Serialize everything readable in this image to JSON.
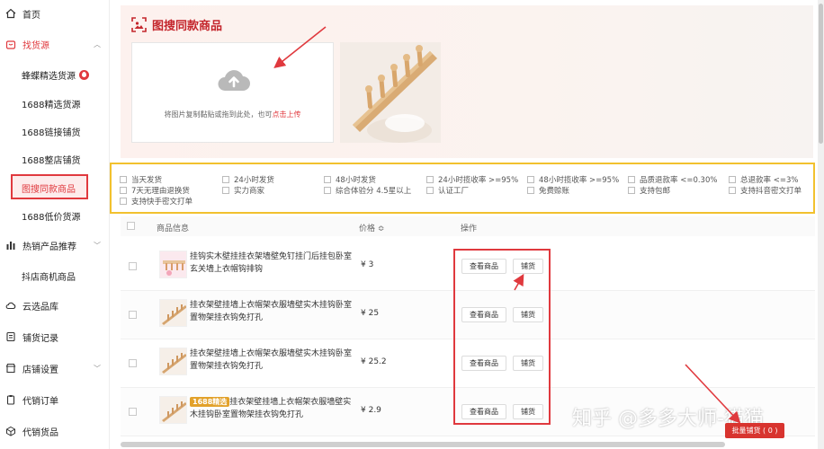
{
  "sidebar": {
    "home": "首页",
    "find_source": "找货源",
    "sub": {
      "wild": "蜂蝶精选货源",
      "p1688": "1688精选货源",
      "link_dist": "1688链接铺货",
      "shop_dist": "1688整店铺货",
      "img_search": "图搜同款商品",
      "low_price": "1688低价货源"
    },
    "hot": "热销产品推荐",
    "douyin": "抖店商机商品",
    "cloud_lib": "云选品库",
    "dist_record": "铺货记录",
    "shop_settings": "店铺设置",
    "agent_order": "代销订单",
    "agent_goods": "代销货品"
  },
  "page": {
    "title": "图搜同款商品",
    "upload_hint": "将图片复制黏贴或拖到此处，也可",
    "upload_link": "点击上传"
  },
  "filters": {
    "row1": [
      "当天发货",
      "24小时发货",
      "48小时发货",
      "24小时揽收率 >=95%",
      "48小时揽收率 >=95%",
      "品质退款率 <=0.30%",
      "总退款率 <=3%"
    ],
    "row2": [
      "7天无理由退换货",
      "实力商家",
      "综合体验分 4.5星以上",
      "认证工厂",
      "免费赊账",
      "支持包邮",
      "支持抖音密文打单"
    ],
    "row3": [
      "支持快手密文打单"
    ]
  },
  "table": {
    "headers": {
      "info": "商品信息",
      "price": "价格 ≎",
      "op": "操作"
    },
    "view_label": "查看商品",
    "dist_label": "铺货",
    "rows": [
      {
        "name": "挂钩实木壁挂挂衣架墙壁免钉挂门后挂包卧室玄关墙上衣帽钩排钩",
        "price": "¥ 3",
        "badge": ""
      },
      {
        "name": "挂衣架壁挂墙上衣帽架衣服墙壁实木挂钩卧室置物架挂衣钩免打孔",
        "price": "¥ 25",
        "badge": ""
      },
      {
        "name": "挂衣架壁挂墙上衣帽架衣服墙壁实木挂钩卧室置物架挂衣钩免打孔",
        "price": "¥ 25.2",
        "badge": ""
      },
      {
        "name": "挂衣架壁挂墙上衣帽架衣服墙壁实木挂钩卧室置物架挂衣钩免打孔",
        "price": "¥ 2.9",
        "badge": "1688精选"
      }
    ]
  },
  "batch_button": "批量铺货 ( 0 )",
  "watermark": "知乎 @多多大师-猫猫",
  "colors": {
    "accent": "#e0393e",
    "highlight": "#f2c12e"
  }
}
